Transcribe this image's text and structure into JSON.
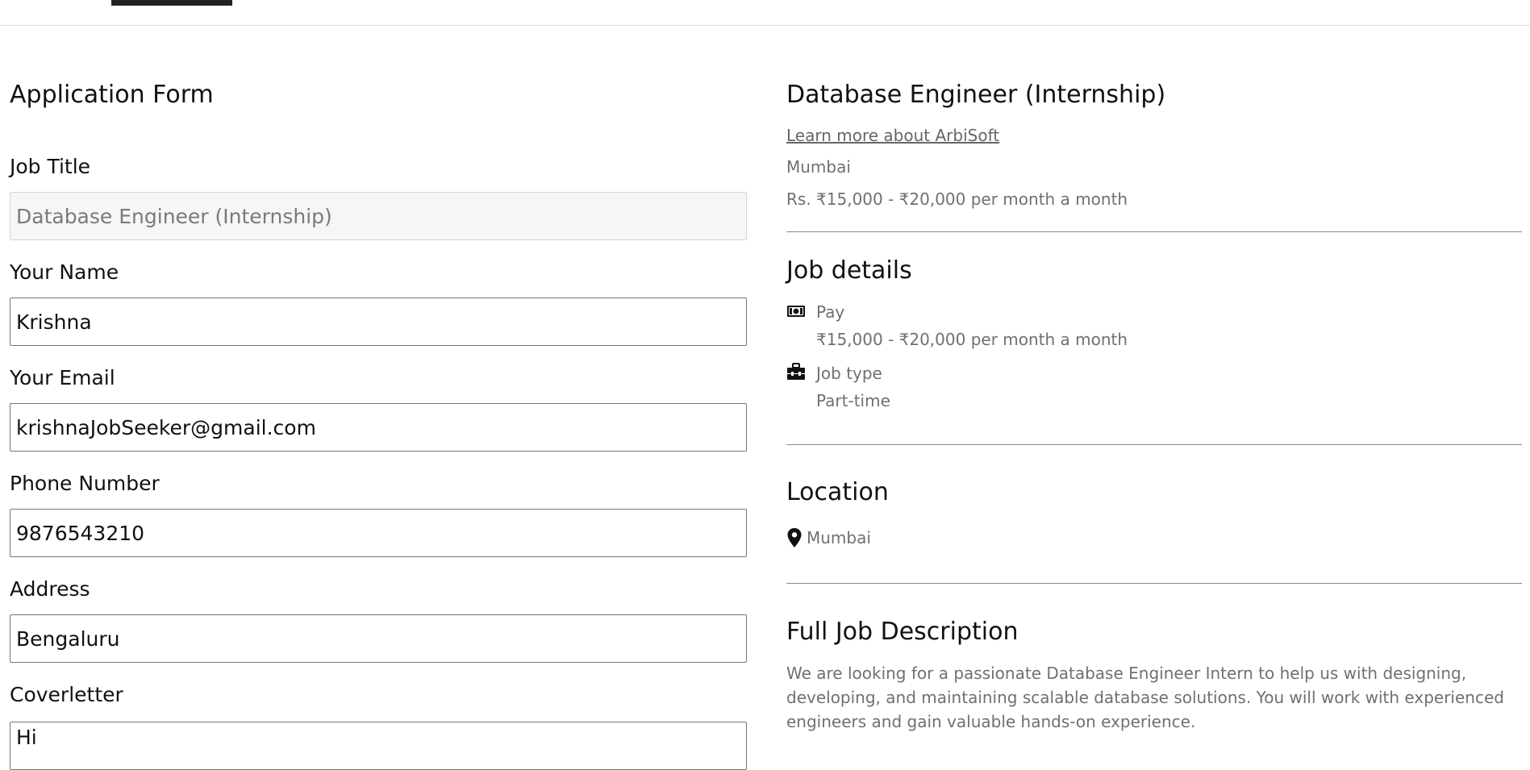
{
  "form": {
    "title": "Application Form",
    "job_title": {
      "label": "Job Title",
      "value": "Database Engineer (Internship)"
    },
    "name": {
      "label": "Your Name",
      "value": "Krishna"
    },
    "email": {
      "label": "Your Email",
      "value": "krishnaJobSeeker@gmail.com"
    },
    "phone": {
      "label": "Phone Number",
      "value": "9876543210"
    },
    "address": {
      "label": "Address",
      "value": "Bengaluru"
    },
    "coverletter": {
      "label": "Coverletter",
      "value": "Hi"
    }
  },
  "job": {
    "title": "Database Engineer (Internship)",
    "learn_more": "Learn more about ArbiSoft",
    "location": "Mumbai",
    "salary": "Rs. ₹15,000 - ₹20,000 per month a month",
    "details": {
      "heading": "Job details",
      "pay_label": "Pay",
      "pay_value": "₹15,000 - ₹20,000 per month a month",
      "type_label": "Job type",
      "type_value": "Part-time"
    },
    "location_section": {
      "heading": "Location",
      "value": "Mumbai"
    },
    "description": {
      "heading": "Full Job Description",
      "text": "We are looking for a passionate Database Engineer Intern to help us with designing, developing, and maintaining scalable database solutions. You will work with experienced engineers and gain valuable hands-on experience."
    }
  },
  "icons": {
    "pay": "money-icon",
    "job_type": "toolbox-icon",
    "location": "map-pin-icon"
  }
}
